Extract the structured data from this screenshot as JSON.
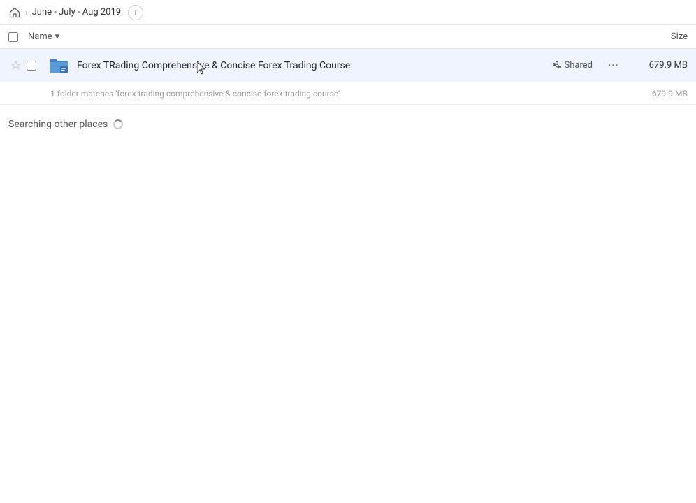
{
  "breadcrumb": {
    "home_label": "Home",
    "path_label": "June - July - Aug 2019",
    "add_button_label": "+"
  },
  "columns": {
    "name_label": "Name",
    "name_sort_icon": "▾",
    "size_label": "Size"
  },
  "file_row": {
    "name": "Forex TRading Comprehensive & Concise Forex Trading Course",
    "shared_label": "Shared",
    "size": "679.9 MB",
    "more_icon": "···"
  },
  "match_row": {
    "text": "1 folder matches 'forex trading comprehensive & concise forex trading course'",
    "size": "679.9 MB"
  },
  "searching_section": {
    "title": "Searching other places"
  }
}
